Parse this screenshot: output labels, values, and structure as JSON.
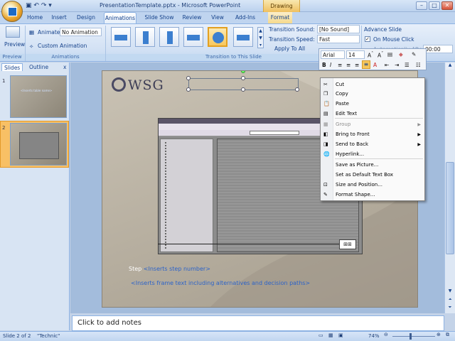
{
  "window": {
    "title": "PresentationTemplate.pptx - Microsoft PowerPoint",
    "contextual_tab_group": "Drawing Tools",
    "controls": [
      "–",
      "□",
      "✕"
    ]
  },
  "tabs": [
    "Home",
    "Insert",
    "Design",
    "Animations",
    "Slide Show",
    "Review",
    "View",
    "Add-Ins",
    "Format"
  ],
  "active_tab": "Animations",
  "ribbon": {
    "preview_label": "Preview",
    "preview_group": "Preview",
    "animate_label": "Animate:",
    "animate_value": "No Animation",
    "custom_animation": "Custom Animation",
    "animations_group": "Animations",
    "transition_sound_label": "Transition Sound:",
    "transition_sound_value": "[No Sound]",
    "transition_speed_label": "Transition Speed:",
    "transition_speed_value": "Fast",
    "apply_to_all": "Apply To All",
    "advance_slide": "Advance Slide",
    "on_mouse_click": "On Mouse Click",
    "automatically_after": "Automatically After:",
    "auto_time": "00:00",
    "transition_group": "Transition to This Slide"
  },
  "mini_toolbar": {
    "font": "Arial",
    "size": "14"
  },
  "left_pane": {
    "tab_slides": "Slides",
    "tab_outline": "Outline",
    "close": "x",
    "slide_numbers": [
      "1",
      "2"
    ],
    "thumb1_text": "<Inserts table name>"
  },
  "slide": {
    "logo": "WSG",
    "step_label": "Step",
    "step_placeholder": "<Inserts step number>",
    "frame_placeholder": "<Inserts frame text including alternatives and decision paths>"
  },
  "context_menu": {
    "items": [
      {
        "label": "Cut",
        "icon": "scissors-icon",
        "enabled": true
      },
      {
        "label": "Copy",
        "icon": "copy-icon",
        "enabled": true
      },
      {
        "label": "Paste",
        "icon": "paste-icon",
        "enabled": true
      },
      {
        "label": "Edit Text",
        "icon": "edit-text-icon",
        "enabled": true
      },
      {
        "label": "Group",
        "icon": "group-icon",
        "enabled": false,
        "submenu": true
      },
      {
        "label": "Bring to Front",
        "icon": "bring-front-icon",
        "enabled": true,
        "submenu": true
      },
      {
        "label": "Send to Back",
        "icon": "send-back-icon",
        "enabled": true,
        "submenu": true
      },
      {
        "label": "Hyperlink...",
        "icon": "hyperlink-icon",
        "enabled": true
      },
      {
        "label": "Save as Picture...",
        "icon": "",
        "enabled": true
      },
      {
        "label": "Set as Default Text Box",
        "icon": "",
        "enabled": true
      },
      {
        "label": "Size and Position...",
        "icon": "size-position-icon",
        "enabled": true
      },
      {
        "label": "Format Shape...",
        "icon": "format-shape-icon",
        "enabled": true
      }
    ]
  },
  "notes": {
    "placeholder": "Click to add notes"
  },
  "status": {
    "slide": "Slide 2 of 2",
    "theme": "\"Technic\"",
    "zoom": "74%"
  },
  "colors": {
    "ribbon_blue": "#d2e1f4",
    "accent_orange": "#f7c75c",
    "placeholder_blue": "#2c63c9"
  }
}
